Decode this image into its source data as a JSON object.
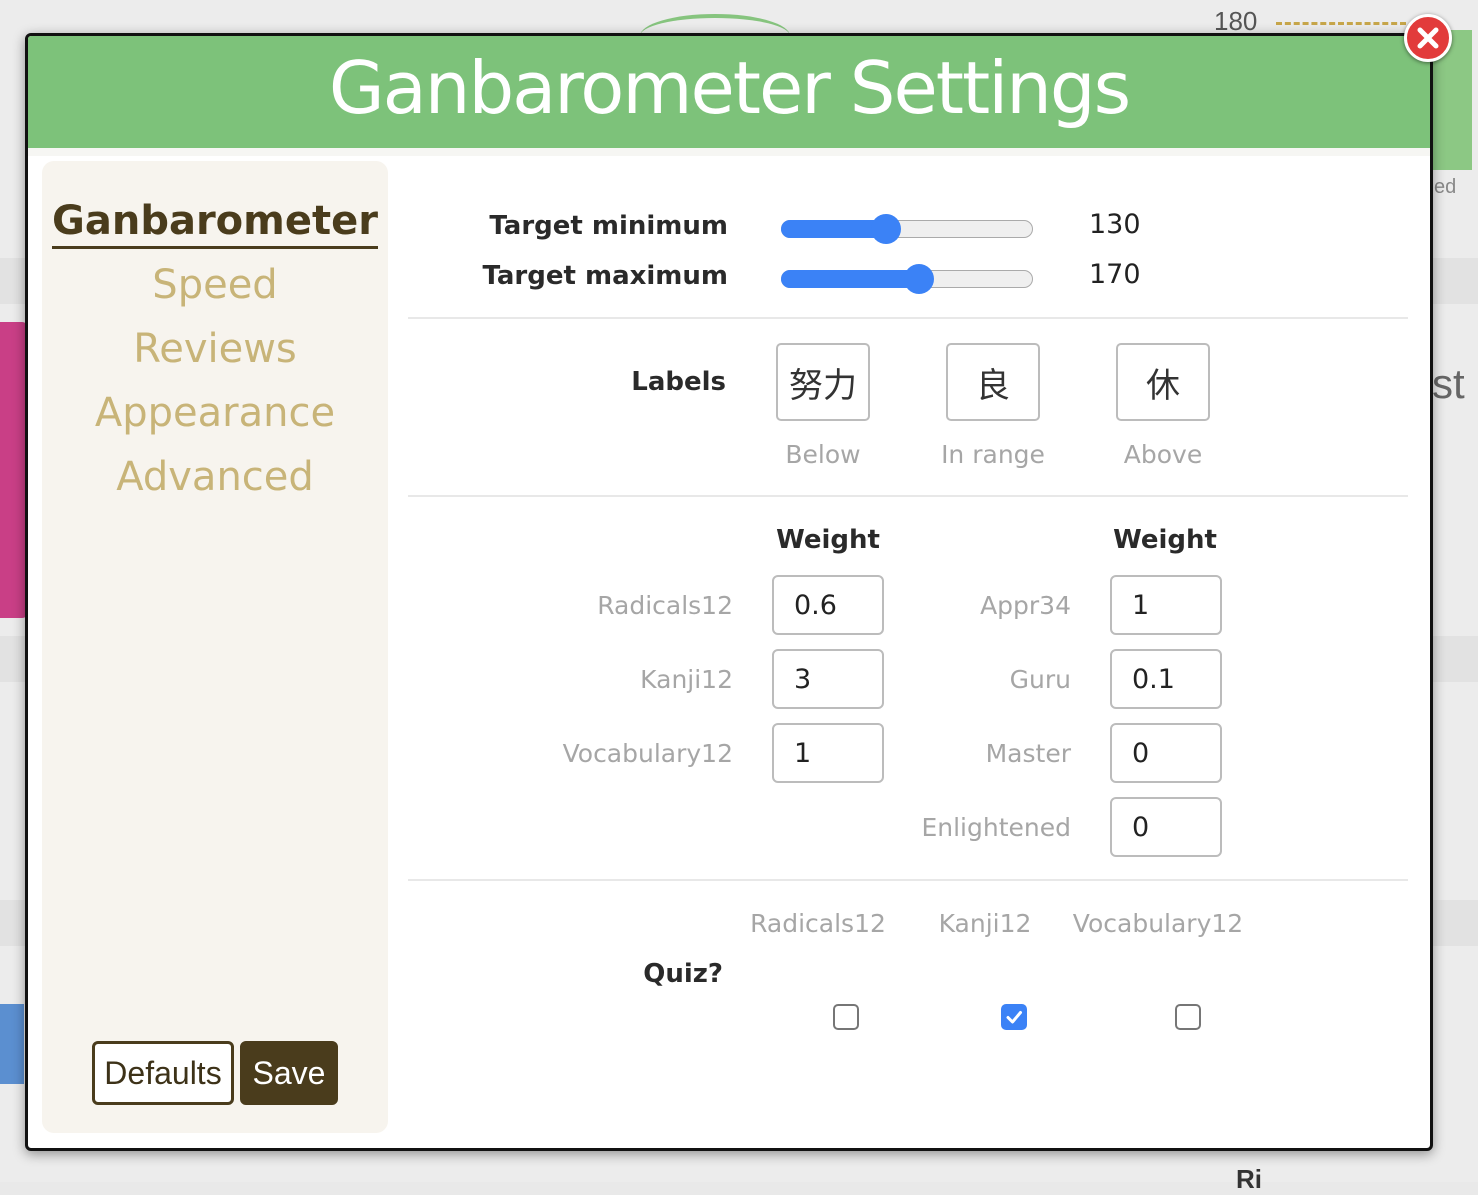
{
  "background": {
    "chart_tick": "180",
    "partial_text_right": "ed",
    "partial_heading": "st",
    "partial_bottom": "Ri"
  },
  "modal": {
    "title": "Ganbarometer Settings",
    "close_icon": "close-x-icon"
  },
  "sidebar": {
    "items": [
      {
        "label": "Ganbarometer",
        "active": true
      },
      {
        "label": "Speed",
        "active": false
      },
      {
        "label": "Reviews",
        "active": false
      },
      {
        "label": "Appearance",
        "active": false
      },
      {
        "label": "Advanced",
        "active": false
      }
    ],
    "defaults_label": "Defaults",
    "save_label": "Save"
  },
  "target": {
    "min_label": "Target minimum",
    "min_value": "130",
    "min_fraction": 0.42,
    "max_label": "Target maximum",
    "max_value": "170",
    "max_fraction": 0.55
  },
  "labels": {
    "heading": "Labels",
    "below": {
      "text": "努力",
      "caption": "Below"
    },
    "in_range": {
      "text": "良",
      "caption": "In range"
    },
    "above": {
      "text": "休",
      "caption": "Above"
    }
  },
  "weights": {
    "heading_left": "Weight",
    "heading_right": "Weight",
    "left": [
      {
        "label": "Radicals12",
        "value": "0.6"
      },
      {
        "label": "Kanji12",
        "value": "3"
      },
      {
        "label": "Vocabulary12",
        "value": "1"
      }
    ],
    "right": [
      {
        "label": "Appr34",
        "value": "1"
      },
      {
        "label": "Guru",
        "value": "0.1"
      },
      {
        "label": "Master",
        "value": "0"
      },
      {
        "label": "Enlightened",
        "value": "0"
      }
    ]
  },
  "quiz": {
    "label": "Quiz?",
    "options": [
      {
        "label": "Radicals12",
        "checked": false
      },
      {
        "label": "Kanji12",
        "checked": true
      },
      {
        "label": "Vocabulary12",
        "checked": false
      }
    ]
  },
  "colors": {
    "header_green": "#7dc27a",
    "accent_brown": "#4a3c1c",
    "nav_inactive": "#c8b478",
    "slider_blue": "#3b82f6",
    "close_red": "#e23b3b"
  }
}
